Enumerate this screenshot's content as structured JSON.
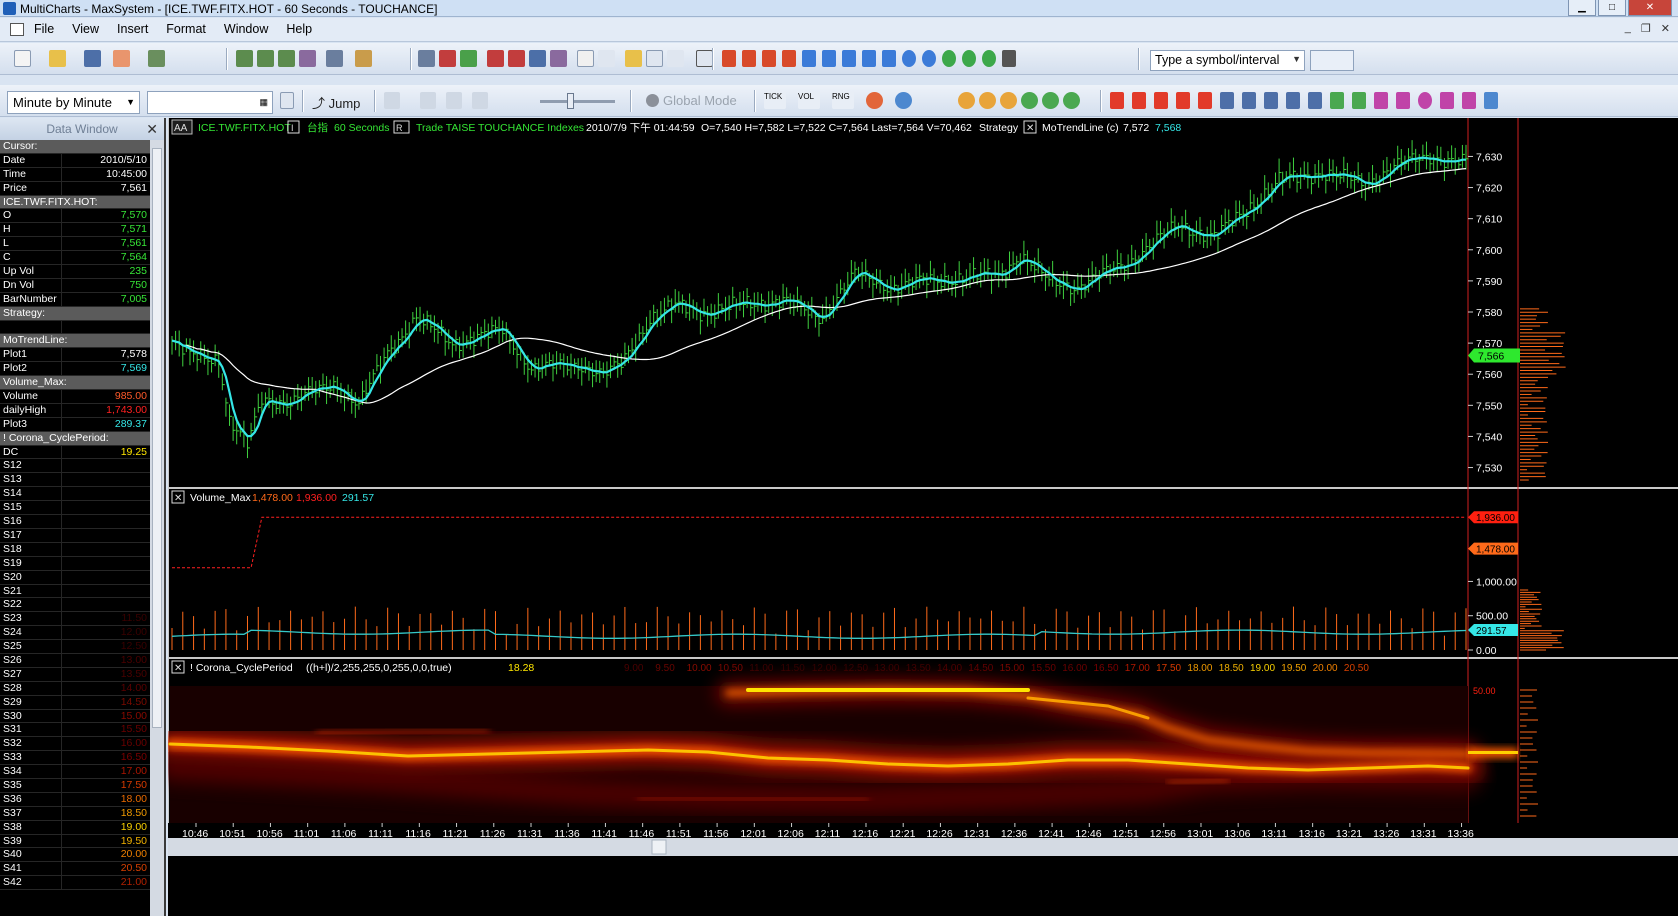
{
  "window": {
    "title": "MultiCharts - MaxSystem - [ICE.TWF.FITX.HOT - 60 Seconds - TOUCHANCE]",
    "minimize": "▁",
    "maximize": "□",
    "close": "✕"
  },
  "menu": {
    "items": [
      "File",
      "View",
      "Insert",
      "Format",
      "Window",
      "Help"
    ],
    "mdi_buttons": [
      "_",
      "❐",
      "✕"
    ]
  },
  "toolbar1": {
    "symbol_placeholder": "Type a symbol/interval"
  },
  "toolbar2": {
    "resolution": "Minute by Minute",
    "jump_label": "Jump",
    "global_mode_label": "Global Mode",
    "tick_label": "TICK",
    "vol_label": "VOL",
    "rng_label": "RNG"
  },
  "data_window": {
    "title": "Data Window",
    "rows": [
      {
        "k": "Cursor:",
        "v": "",
        "hdr": true
      },
      {
        "k": "Date",
        "v": "2010/5/10",
        "c": "#ffffff"
      },
      {
        "k": "Time",
        "v": "10:45:00",
        "c": "#ffffff"
      },
      {
        "k": "Price",
        "v": "7,561",
        "c": "#ffffff"
      },
      {
        "k": "ICE.TWF.FITX.HOT:",
        "v": "",
        "hdr": true
      },
      {
        "k": "O",
        "v": "7,570",
        "c": "#37e637"
      },
      {
        "k": "H",
        "v": "7,571",
        "c": "#37e637"
      },
      {
        "k": "L",
        "v": "7,561",
        "c": "#37e637"
      },
      {
        "k": "C",
        "v": "7,564",
        "c": "#37e637"
      },
      {
        "k": "Up Vol",
        "v": "235",
        "c": "#37e637"
      },
      {
        "k": "Dn Vol",
        "v": "750",
        "c": "#37e637"
      },
      {
        "k": "BarNumber",
        "v": "7,005",
        "c": "#37e637"
      },
      {
        "k": "Strategy:",
        "v": "",
        "hdr": true
      },
      {
        "k": "",
        "v": "",
        "c": "#ffffff"
      },
      {
        "k": "MoTrendLine:",
        "v": "",
        "hdr": true
      },
      {
        "k": "Plot1",
        "v": "7,578",
        "c": "#ffffff"
      },
      {
        "k": "Plot2",
        "v": "7,569",
        "c": "#35e6e6"
      },
      {
        "k": "Volume_Max:",
        "v": "",
        "hdr": true
      },
      {
        "k": "Volume",
        "v": "985.00",
        "c": "#ff5a2a"
      },
      {
        "k": "dailyHigh",
        "v": "1,743.00",
        "c": "#ff2020"
      },
      {
        "k": "Plot3",
        "v": "289.37",
        "c": "#35e6e6"
      },
      {
        "k": "! Corona_CyclePeriod:",
        "v": "",
        "hdr": true
      },
      {
        "k": "DC",
        "v": "19.25",
        "c": "#ffe600"
      },
      {
        "k": "S12",
        "v": "",
        "c": "#5a0000"
      },
      {
        "k": "S13",
        "v": "",
        "c": "#5a0000"
      },
      {
        "k": "S14",
        "v": "",
        "c": "#5a0000"
      },
      {
        "k": "S15",
        "v": "",
        "c": "#5a0000"
      },
      {
        "k": "S16",
        "v": "",
        "c": "#5a0000"
      },
      {
        "k": "S17",
        "v": "",
        "c": "#5a0000"
      },
      {
        "k": "S18",
        "v": "",
        "c": "#5a0000"
      },
      {
        "k": "S19",
        "v": "",
        "c": "#5a0000"
      },
      {
        "k": "S20",
        "v": "",
        "c": "#5a0000"
      },
      {
        "k": "S21",
        "v": "",
        "c": "#5a0000"
      },
      {
        "k": "S22",
        "v": "",
        "c": "#5a0000"
      },
      {
        "k": "S23",
        "v": "11.50",
        "c": "#3a0000"
      },
      {
        "k": "S24",
        "v": "12.00",
        "c": "#3a0000"
      },
      {
        "k": "S25",
        "v": "12.50",
        "c": "#3a0000"
      },
      {
        "k": "S26",
        "v": "13.00",
        "c": "#4a0000"
      },
      {
        "k": "S27",
        "v": "13.50",
        "c": "#4a0000"
      },
      {
        "k": "S28",
        "v": "14.00",
        "c": "#5a0000"
      },
      {
        "k": "S29",
        "v": "14.50",
        "c": "#7a0a00"
      },
      {
        "k": "S30",
        "v": "15.00",
        "c": "#8a0a00"
      },
      {
        "k": "S31",
        "v": "15.50",
        "c": "#6a0000"
      },
      {
        "k": "S32",
        "v": "16.00",
        "c": "#6a0000"
      },
      {
        "k": "S33",
        "v": "16.50",
        "c": "#7a0000"
      },
      {
        "k": "S34",
        "v": "17.00",
        "c": "#aa1500"
      },
      {
        "k": "S35",
        "v": "17.50",
        "c": "#d83a00"
      },
      {
        "k": "S36",
        "v": "18.00",
        "c": "#e86a00"
      },
      {
        "k": "S37",
        "v": "18.50",
        "c": "#f09a00"
      },
      {
        "k": "S38",
        "v": "19.00",
        "c": "#f8d000"
      },
      {
        "k": "S39",
        "v": "19.50",
        "c": "#f0b000"
      },
      {
        "k": "S40",
        "v": "20.00",
        "c": "#f08000"
      },
      {
        "k": "S41",
        "v": "20.50",
        "c": "#d84000"
      },
      {
        "k": "S42",
        "v": "21.00",
        "c": "#b02000"
      }
    ]
  },
  "chart": {
    "header": {
      "aa": "AA",
      "symbol": "ICE.TWF.FITX.HOT",
      "i_badge": "I",
      "exchange_cn": "台指",
      "interval": "60 Seconds",
      "r_badge": "R",
      "datafeed": "Trade TAISE TOUCHANCE Indexes",
      "datetime": "2010/7/9 下午 01:44:59",
      "ohlc": "O=7,540 H=7,582 L=7,522 C=7,564 Last=7,564 V=70,462",
      "strategy": "Strategy",
      "indicator": "MoTrendLine (c)",
      "ind_v1": "7,572",
      "ind_v2": "7,568"
    },
    "price_axis": [
      "7,630",
      "7,620",
      "7,610",
      "7,600",
      "7,590",
      "7,580",
      "7,570",
      "7,560",
      "7,550",
      "7,540",
      "7,530"
    ],
    "price_marker": "7,566",
    "volume_pane": {
      "name": "Volume_Max",
      "v1": "1,478.00",
      "v2": "1,936.00",
      "v3": "291.57",
      "axis": [
        "1,000.00",
        "500.00",
        "0.00"
      ],
      "marker_high": "1,936.00",
      "marker_max": "1,478.00",
      "marker_avg": "291.57"
    },
    "corona_pane": {
      "name": "! Corona_CyclePeriod",
      "params": "((h+l)/2,255,255,0,255,0,0,true)",
      "value": "18.28",
      "scale": [
        "9.00",
        "9.50",
        "10.00",
        "10.50",
        "11.00",
        "11.50",
        "12.00",
        "12.50",
        "13.00",
        "13.50",
        "14.00",
        "14.50",
        "15.00",
        "15.50",
        "16.00",
        "16.50",
        "17.00",
        "17.50",
        "18.00",
        "18.50",
        "19.00",
        "19.50",
        "20.00",
        "20.50"
      ],
      "top_label": "50.00"
    },
    "time_axis": [
      "10:46",
      "10:51",
      "10:56",
      "11:01",
      "11:06",
      "11:11",
      "11:16",
      "11:21",
      "11:26",
      "11:31",
      "11:36",
      "11:41",
      "11:46",
      "11:51",
      "11:56",
      "12:01",
      "12:06",
      "12:11",
      "12:16",
      "12:21",
      "12:26",
      "12:31",
      "12:36",
      "12:41",
      "12:46",
      "12:51",
      "12:56",
      "13:01",
      "13:06",
      "13:11",
      "13:16",
      "13:21",
      "13:26",
      "13:31",
      "13:36"
    ]
  },
  "colors": {
    "bars": "#3fd13f",
    "fast_line": "#35e6e6",
    "slow_line": "#ffffff",
    "volume": "#ff6a1a",
    "daily_high": "#ff2020",
    "avg_volume": "#35c8c8",
    "marker_green": "#2ee82e",
    "marker_red": "#ff2010",
    "marker_orange": "#ff6a1a",
    "axis_text": "#ffffff"
  }
}
